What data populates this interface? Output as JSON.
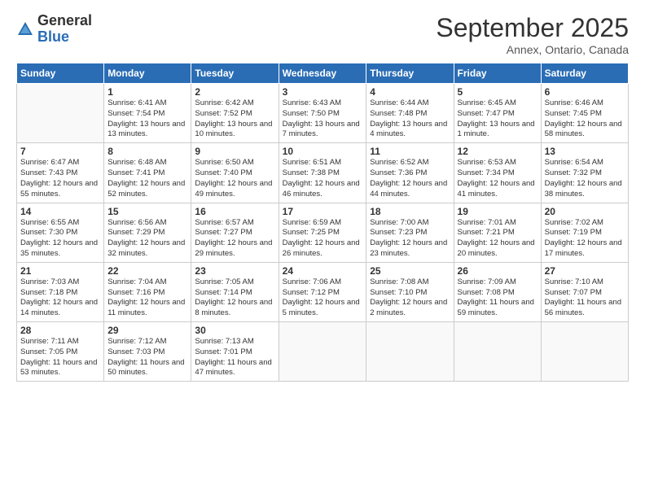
{
  "logo": {
    "general": "General",
    "blue": "Blue"
  },
  "header": {
    "month": "September 2025",
    "location": "Annex, Ontario, Canada"
  },
  "days_of_week": [
    "Sunday",
    "Monday",
    "Tuesday",
    "Wednesday",
    "Thursday",
    "Friday",
    "Saturday"
  ],
  "weeks": [
    [
      {
        "num": "",
        "sunrise": "",
        "sunset": "",
        "daylight": ""
      },
      {
        "num": "1",
        "sunrise": "Sunrise: 6:41 AM",
        "sunset": "Sunset: 7:54 PM",
        "daylight": "Daylight: 13 hours and 13 minutes."
      },
      {
        "num": "2",
        "sunrise": "Sunrise: 6:42 AM",
        "sunset": "Sunset: 7:52 PM",
        "daylight": "Daylight: 13 hours and 10 minutes."
      },
      {
        "num": "3",
        "sunrise": "Sunrise: 6:43 AM",
        "sunset": "Sunset: 7:50 PM",
        "daylight": "Daylight: 13 hours and 7 minutes."
      },
      {
        "num": "4",
        "sunrise": "Sunrise: 6:44 AM",
        "sunset": "Sunset: 7:48 PM",
        "daylight": "Daylight: 13 hours and 4 minutes."
      },
      {
        "num": "5",
        "sunrise": "Sunrise: 6:45 AM",
        "sunset": "Sunset: 7:47 PM",
        "daylight": "Daylight: 13 hours and 1 minute."
      },
      {
        "num": "6",
        "sunrise": "Sunrise: 6:46 AM",
        "sunset": "Sunset: 7:45 PM",
        "daylight": "Daylight: 12 hours and 58 minutes."
      }
    ],
    [
      {
        "num": "7",
        "sunrise": "Sunrise: 6:47 AM",
        "sunset": "Sunset: 7:43 PM",
        "daylight": "Daylight: 12 hours and 55 minutes."
      },
      {
        "num": "8",
        "sunrise": "Sunrise: 6:48 AM",
        "sunset": "Sunset: 7:41 PM",
        "daylight": "Daylight: 12 hours and 52 minutes."
      },
      {
        "num": "9",
        "sunrise": "Sunrise: 6:50 AM",
        "sunset": "Sunset: 7:40 PM",
        "daylight": "Daylight: 12 hours and 49 minutes."
      },
      {
        "num": "10",
        "sunrise": "Sunrise: 6:51 AM",
        "sunset": "Sunset: 7:38 PM",
        "daylight": "Daylight: 12 hours and 46 minutes."
      },
      {
        "num": "11",
        "sunrise": "Sunrise: 6:52 AM",
        "sunset": "Sunset: 7:36 PM",
        "daylight": "Daylight: 12 hours and 44 minutes."
      },
      {
        "num": "12",
        "sunrise": "Sunrise: 6:53 AM",
        "sunset": "Sunset: 7:34 PM",
        "daylight": "Daylight: 12 hours and 41 minutes."
      },
      {
        "num": "13",
        "sunrise": "Sunrise: 6:54 AM",
        "sunset": "Sunset: 7:32 PM",
        "daylight": "Daylight: 12 hours and 38 minutes."
      }
    ],
    [
      {
        "num": "14",
        "sunrise": "Sunrise: 6:55 AM",
        "sunset": "Sunset: 7:30 PM",
        "daylight": "Daylight: 12 hours and 35 minutes."
      },
      {
        "num": "15",
        "sunrise": "Sunrise: 6:56 AM",
        "sunset": "Sunset: 7:29 PM",
        "daylight": "Daylight: 12 hours and 32 minutes."
      },
      {
        "num": "16",
        "sunrise": "Sunrise: 6:57 AM",
        "sunset": "Sunset: 7:27 PM",
        "daylight": "Daylight: 12 hours and 29 minutes."
      },
      {
        "num": "17",
        "sunrise": "Sunrise: 6:59 AM",
        "sunset": "Sunset: 7:25 PM",
        "daylight": "Daylight: 12 hours and 26 minutes."
      },
      {
        "num": "18",
        "sunrise": "Sunrise: 7:00 AM",
        "sunset": "Sunset: 7:23 PM",
        "daylight": "Daylight: 12 hours and 23 minutes."
      },
      {
        "num": "19",
        "sunrise": "Sunrise: 7:01 AM",
        "sunset": "Sunset: 7:21 PM",
        "daylight": "Daylight: 12 hours and 20 minutes."
      },
      {
        "num": "20",
        "sunrise": "Sunrise: 7:02 AM",
        "sunset": "Sunset: 7:19 PM",
        "daylight": "Daylight: 12 hours and 17 minutes."
      }
    ],
    [
      {
        "num": "21",
        "sunrise": "Sunrise: 7:03 AM",
        "sunset": "Sunset: 7:18 PM",
        "daylight": "Daylight: 12 hours and 14 minutes."
      },
      {
        "num": "22",
        "sunrise": "Sunrise: 7:04 AM",
        "sunset": "Sunset: 7:16 PM",
        "daylight": "Daylight: 12 hours and 11 minutes."
      },
      {
        "num": "23",
        "sunrise": "Sunrise: 7:05 AM",
        "sunset": "Sunset: 7:14 PM",
        "daylight": "Daylight: 12 hours and 8 minutes."
      },
      {
        "num": "24",
        "sunrise": "Sunrise: 7:06 AM",
        "sunset": "Sunset: 7:12 PM",
        "daylight": "Daylight: 12 hours and 5 minutes."
      },
      {
        "num": "25",
        "sunrise": "Sunrise: 7:08 AM",
        "sunset": "Sunset: 7:10 PM",
        "daylight": "Daylight: 12 hours and 2 minutes."
      },
      {
        "num": "26",
        "sunrise": "Sunrise: 7:09 AM",
        "sunset": "Sunset: 7:08 PM",
        "daylight": "Daylight: 11 hours and 59 minutes."
      },
      {
        "num": "27",
        "sunrise": "Sunrise: 7:10 AM",
        "sunset": "Sunset: 7:07 PM",
        "daylight": "Daylight: 11 hours and 56 minutes."
      }
    ],
    [
      {
        "num": "28",
        "sunrise": "Sunrise: 7:11 AM",
        "sunset": "Sunset: 7:05 PM",
        "daylight": "Daylight: 11 hours and 53 minutes."
      },
      {
        "num": "29",
        "sunrise": "Sunrise: 7:12 AM",
        "sunset": "Sunset: 7:03 PM",
        "daylight": "Daylight: 11 hours and 50 minutes."
      },
      {
        "num": "30",
        "sunrise": "Sunrise: 7:13 AM",
        "sunset": "Sunset: 7:01 PM",
        "daylight": "Daylight: 11 hours and 47 minutes."
      },
      {
        "num": "",
        "sunrise": "",
        "sunset": "",
        "daylight": ""
      },
      {
        "num": "",
        "sunrise": "",
        "sunset": "",
        "daylight": ""
      },
      {
        "num": "",
        "sunrise": "",
        "sunset": "",
        "daylight": ""
      },
      {
        "num": "",
        "sunrise": "",
        "sunset": "",
        "daylight": ""
      }
    ]
  ]
}
